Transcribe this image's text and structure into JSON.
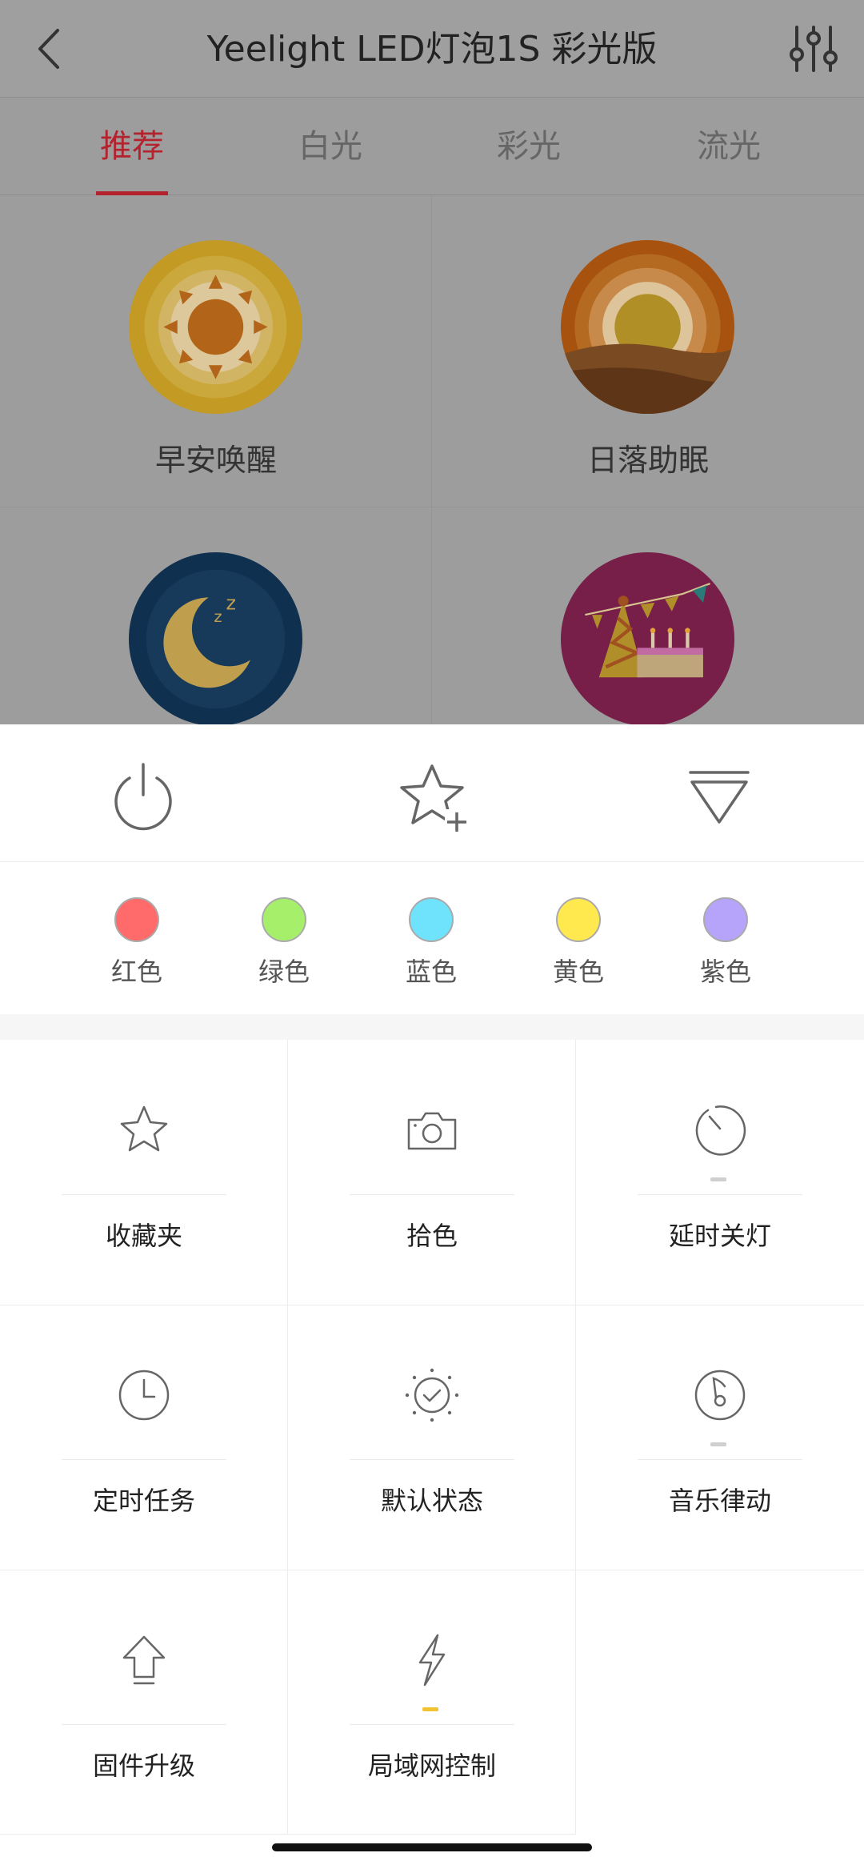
{
  "header": {
    "title": "Yeelight LED灯泡1S 彩光版",
    "back_icon": "chevron-left-icon",
    "settings_icon": "sliders-icon"
  },
  "tabs": [
    {
      "label": "推荐",
      "active": true
    },
    {
      "label": "白光",
      "active": false
    },
    {
      "label": "彩光",
      "active": false
    },
    {
      "label": "流光",
      "active": false
    }
  ],
  "scenes": [
    {
      "label": "早安唤醒",
      "icon": "sunrise-scene-icon"
    },
    {
      "label": "日落助眠",
      "icon": "sunset-scene-icon"
    },
    {
      "label": "",
      "icon": "moon-sleep-scene-icon"
    },
    {
      "label": "",
      "icon": "party-scene-icon"
    }
  ],
  "controls": {
    "power_icon": "power-icon",
    "favorite_add_icon": "star-plus-icon",
    "collapse_icon": "collapse-triangle-icon"
  },
  "colors": [
    {
      "label": "红色",
      "hex": "#ff6b6b"
    },
    {
      "label": "绿色",
      "hex": "#a6ef6a"
    },
    {
      "label": "蓝色",
      "hex": "#6fe3fb"
    },
    {
      "label": "黄色",
      "hex": "#ffe94f"
    },
    {
      "label": "紫色",
      "hex": "#b6a4fb"
    }
  ],
  "features": [
    {
      "label": "收藏夹",
      "icon": "star-icon",
      "indicator": "none"
    },
    {
      "label": "拾色",
      "icon": "camera-icon",
      "indicator": "none"
    },
    {
      "label": "延时关灯",
      "icon": "delay-timer-icon",
      "indicator": "off"
    },
    {
      "label": "定时任务",
      "icon": "clock-icon",
      "indicator": "none"
    },
    {
      "label": "默认状态",
      "icon": "default-state-icon",
      "indicator": "none"
    },
    {
      "label": "音乐律动",
      "icon": "music-icon",
      "indicator": "off"
    },
    {
      "label": "固件升级",
      "icon": "upgrade-arrow-icon",
      "indicator": "none"
    },
    {
      "label": "局域网控制",
      "icon": "lightning-icon",
      "indicator": "on"
    }
  ],
  "theme": {
    "accent": "#b3222d",
    "indicator_on": "#f1c232",
    "indicator_off": "#cfcfcf"
  }
}
